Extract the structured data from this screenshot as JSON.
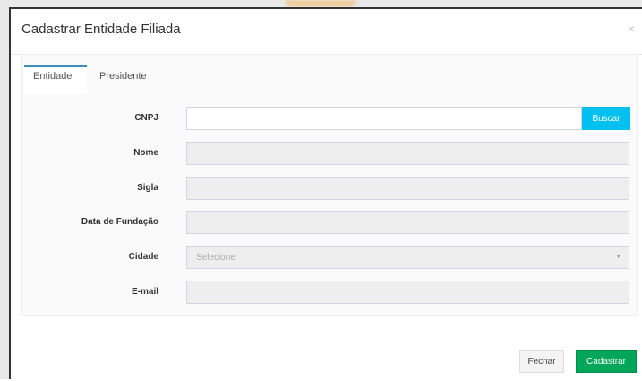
{
  "modal": {
    "title": "Cadastrar Entidade Filiada",
    "close_glyph": "×"
  },
  "tabs": [
    {
      "label": "Entidade",
      "active": true
    },
    {
      "label": "Presidente",
      "active": false
    }
  ],
  "form": {
    "cnpj": {
      "label": "CNPJ",
      "value": ""
    },
    "buscar_label": "Buscar",
    "nome": {
      "label": "Nome",
      "value": ""
    },
    "sigla": {
      "label": "Sigla",
      "value": ""
    },
    "data_fundacao": {
      "label": "Data de Fundação",
      "value": ""
    },
    "cidade": {
      "label": "Cidade",
      "selected": "Selecione"
    },
    "email": {
      "label": "E-mail",
      "value": ""
    }
  },
  "footer": {
    "fechar_label": "Fechar",
    "cadastrar_label": "Cadastrar"
  },
  "colors": {
    "buscar": "#00c0ef",
    "cadastrar": "#00a65a",
    "tab_active": "#3c8dbc"
  },
  "icons": {
    "close": "close-icon",
    "select_caret": "caret-down-icon"
  }
}
